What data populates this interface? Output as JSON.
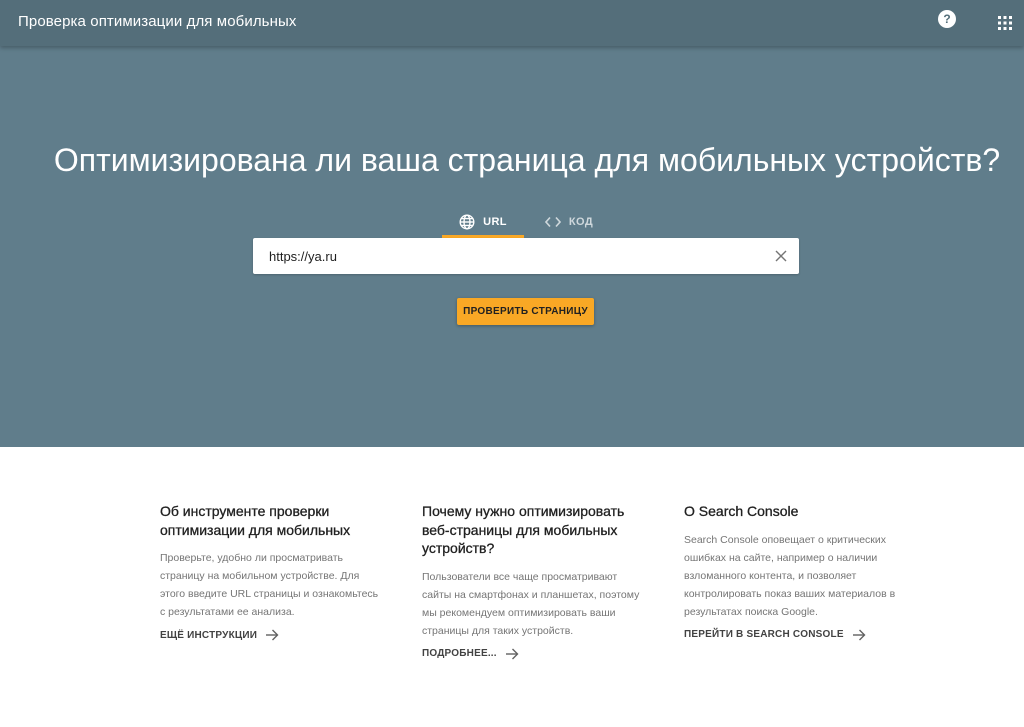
{
  "header": {
    "title": "Проверка оптимизации для мобильных",
    "help_icon_glyph": "?",
    "help_icon": "help-circle-icon",
    "apps_icon": "apps-grid-icon"
  },
  "hero": {
    "headline": "Оптимизирована ли ваша страница для мобильных устройств?",
    "tabs": [
      {
        "label": "URL",
        "icon": "globe-icon",
        "active": true
      },
      {
        "label": "КОД",
        "icon": "code-icon",
        "active": false
      }
    ],
    "url_input": {
      "value": "https://ya.ru"
    },
    "check_button": "ПРОВЕРИТЬ СТРАНИЦУ"
  },
  "info": [
    {
      "title": "Об инструменте проверки оптимизации для мобильных",
      "text": "Проверьте, удобно ли просматривать страницу на мобильном устройстве. Для этого введите URL страницы и ознакомьтесь с результатами ее анализа.",
      "link": "ЕЩЁ ИНСТРУКЦИИ"
    },
    {
      "title": "Почему нужно оптимизировать веб-страницы для мобильных устройств?",
      "text": "Пользователи все чаще просматривают сайты на смартфонах и планшетах, поэтому мы рекомендуем оптимизировать ваши страницы для таких устройств.",
      "link": "ПОДРОБНЕЕ..."
    },
    {
      "title": "О Search Console",
      "text": "Search Console оповещает о критических ошибках на сайте, например о наличии взломанного контента, и позволяет контролировать показ ваших материалов в результатах поиска Google.",
      "link": "ПЕРЕЙТИ В SEARCH CONSOLE"
    }
  ],
  "colors": {
    "header_bg": "#546e7a",
    "hero_bg": "#607d8b",
    "accent": "#f9a825"
  }
}
